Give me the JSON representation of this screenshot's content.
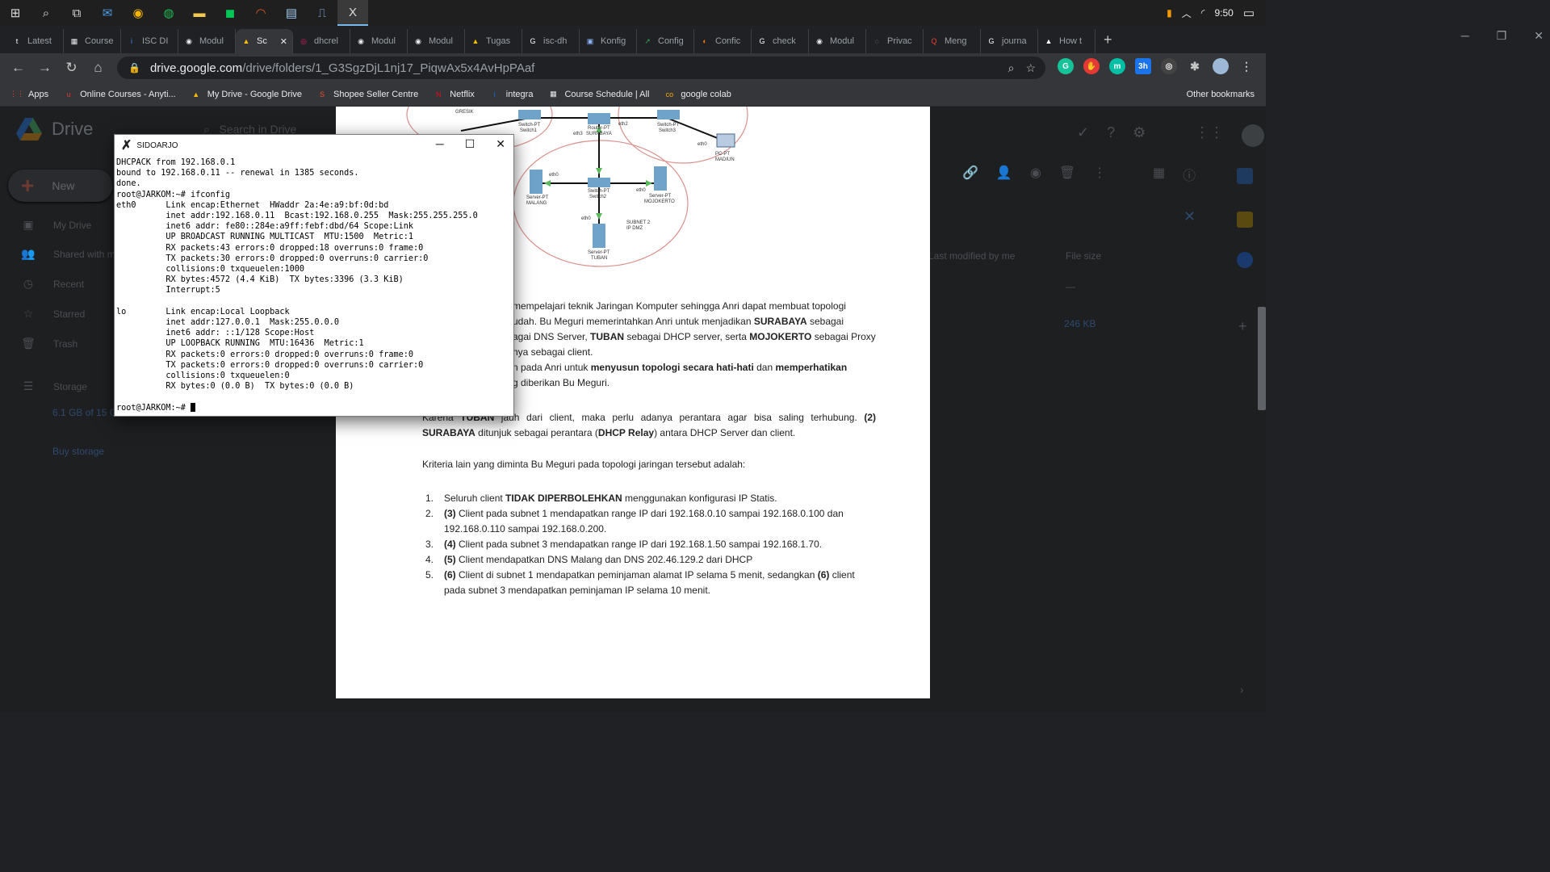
{
  "taskbar": {
    "icons": [
      "windows-start-icon",
      "search-icon",
      "task-view-icon",
      "mail-icon",
      "chrome-icon",
      "spotify-icon",
      "file-explorer-icon",
      "line-icon",
      "ubuntu-icon",
      "notepad-icon",
      "network-icon",
      "xming-icon"
    ],
    "time": "9:50"
  },
  "tabs": [
    {
      "label": "Latest",
      "color": "#ffffff",
      "glyph": "t"
    },
    {
      "label": "Course",
      "color": "#e8eaed",
      "glyph": "▦"
    },
    {
      "label": "ISC DI",
      "color": "#4285f4",
      "glyph": "i"
    },
    {
      "label": "Modul",
      "color": "#e8eaed",
      "glyph": "◉"
    },
    {
      "label": "Sc",
      "color": "#fbbc04",
      "glyph": "▲",
      "active": true
    },
    {
      "label": "dhcrel",
      "color": "#e91e63",
      "glyph": "◎"
    },
    {
      "label": "Modul",
      "color": "#e8eaed",
      "glyph": "◉"
    },
    {
      "label": "Modul",
      "color": "#e8eaed",
      "glyph": "◉"
    },
    {
      "label": "Tugas",
      "color": "#fbbc04",
      "glyph": "▲"
    },
    {
      "label": "isc-dh",
      "color": "#ffffff",
      "glyph": "G"
    },
    {
      "label": "Konfig",
      "color": "#8ab4f8",
      "glyph": "▣"
    },
    {
      "label": "Config",
      "color": "#34a853",
      "glyph": "↗"
    },
    {
      "label": "Confic",
      "color": "#f57c00",
      "glyph": "◐"
    },
    {
      "label": "check",
      "color": "#ffffff",
      "glyph": "G"
    },
    {
      "label": "Modul",
      "color": "#e8eaed",
      "glyph": "◉"
    },
    {
      "label": "Privac",
      "color": "#9aa0a6",
      "glyph": "◌"
    },
    {
      "label": "Meng",
      "color": "#ea4335",
      "glyph": "Q"
    },
    {
      "label": "journa",
      "color": "#ffffff",
      "glyph": "G"
    },
    {
      "label": "How t",
      "color": "#ffffff",
      "glyph": "▲"
    }
  ],
  "address": {
    "host": "drive.google.com",
    "path": "/drive/folders/1_G3SgzDjL1nj17_PiqwAx5x4AvHpPAaf"
  },
  "bookmarks": [
    {
      "label": "Apps",
      "color": "#ea4335",
      "glyph": "⋮⋮"
    },
    {
      "label": "Online Courses - Anyti...",
      "color": "#e53935",
      "glyph": "u"
    },
    {
      "label": "My Drive - Google Drive",
      "color": "#fbbc04",
      "glyph": "▲"
    },
    {
      "label": "Shopee Seller Centre",
      "color": "#ee4d2d",
      "glyph": "S"
    },
    {
      "label": "Netflix",
      "color": "#e50914",
      "glyph": "N"
    },
    {
      "label": "integra",
      "color": "#1a73e8",
      "glyph": "i"
    },
    {
      "label": "Course Schedule | All",
      "color": "#e8eaed",
      "glyph": "▦"
    },
    {
      "label": "google colab",
      "color": "#f9ab00",
      "glyph": "co"
    }
  ],
  "bookmarks_other": "Other bookmarks",
  "drive": {
    "brand": "Drive",
    "search_placeholder": "Search in Drive",
    "new_label": "New",
    "sidebar": [
      {
        "label": "My Drive",
        "icon": "my-drive-icon",
        "glyph": "▣"
      },
      {
        "label": "Shared with me",
        "icon": "people-icon",
        "glyph": "👥"
      },
      {
        "label": "Recent",
        "icon": "clock-icon",
        "glyph": "◷"
      },
      {
        "label": "Starred",
        "icon": "star-icon",
        "glyph": "☆"
      },
      {
        "label": "Trash",
        "icon": "trash-icon",
        "glyph": "🗑"
      }
    ],
    "storage_label": "Storage",
    "storage_used": "6.1 GB of 15 GB used",
    "buy_storage": "Buy storage",
    "col_modified": "Last modified by me",
    "col_size": "File size",
    "row_size_1": "—",
    "row_size_2": "246 KB"
  },
  "document": {
    "para1": "mempelajari teknik Jaringan Komputer sehingga Anri dapat membuat topologi udah. Bu Meguri memerintahkan Anri untuk menjadikan SURABAYA sebagai sebagai DNS Server, TUBAN sebagai DHCP server, serta MOJOKERTO sebagai Proxy nya sebagai client.",
    "para2": "n pada Anri untuk menyusun topologi secara hati-hati dan memperhatikan g diberikan Bu Meguri.",
    "para3": "Karena TUBAN jauh dari client, maka perlu adanya perantara agar bisa saling terhubung. (2) SURABAYA ditunjuk sebagai perantara (DHCP Relay) antara DHCP Server dan client.",
    "para4": "Kriteria lain yang diminta Bu Meguri pada topologi jaringan tersebut adalah:",
    "list": [
      "Seluruh client TIDAK DIPERBOLEHKAN menggunakan konfigurasi IP Statis.",
      "(3) Client pada subnet 1 mendapatkan range IP dari 192.168.0.10 sampai 192.168.0.100 dan 192.168.0.110 sampai 192.168.0.200.",
      "(4) Client pada subnet 3 mendapatkan range IP dari 192.168.1.50 sampai 192.168.1.70.",
      "(5) Client mendapatkan DNS Malang dan DNS 202.46.129.2 dari DHCP",
      "(6) Client di subnet 1 mendapatkan peminjaman alamat IP selama 5 menit, sedangkan (6) client pada subnet 3 mendapatkan peminjaman IP selama 10 menit."
    ],
    "diagram": {
      "labels": [
        "GRESIK",
        "Switch-PT Switch1",
        "Router-PT SURABAYA",
        "Switch-PT Switch3",
        "eth3",
        "eth2",
        "eth0",
        "PC-PT MADIUN",
        "Server-PT MALANG",
        "Switch-PT Switch2",
        "Server-PT MOJOKERTO",
        "SUBNET 2 IP DMZ",
        "Server-PT TUBAN"
      ]
    }
  },
  "xterm": {
    "title": "SIDOARJO",
    "lines": [
      "DHCPACK from 192.168.0.1",
      "bound to 192.168.0.11 -- renewal in 1385 seconds.",
      "done.",
      "root@JARKOM:~# ifconfig",
      "eth0      Link encap:Ethernet  HWaddr 2a:4e:a9:bf:0d:bd",
      "          inet addr:192.168.0.11  Bcast:192.168.0.255  Mask:255.255.255.0",
      "          inet6 addr: fe80::284e:a9ff:febf:dbd/64 Scope:Link",
      "          UP BROADCAST RUNNING MULTICAST  MTU:1500  Metric:1",
      "          RX packets:43 errors:0 dropped:18 overruns:0 frame:0",
      "          TX packets:30 errors:0 dropped:0 overruns:0 carrier:0",
      "          collisions:0 txqueuelen:1000",
      "          RX bytes:4572 (4.4 KiB)  TX bytes:3396 (3.3 KiB)",
      "          Interrupt:5",
      "",
      "lo        Link encap:Local Loopback",
      "          inet addr:127.0.0.1  Mask:255.0.0.0",
      "          inet6 addr: ::1/128 Scope:Host",
      "          UP LOOPBACK RUNNING  MTU:16436  Metric:1",
      "          RX packets:0 errors:0 dropped:0 overruns:0 frame:0",
      "          TX packets:0 errors:0 dropped:0 overruns:0 carrier:0",
      "          collisions:0 txqueuelen:0",
      "          RX bytes:0 (0.0 B)  TX bytes:0 (0.0 B)",
      ""
    ],
    "prompt": "root@JARKOM:~# "
  }
}
